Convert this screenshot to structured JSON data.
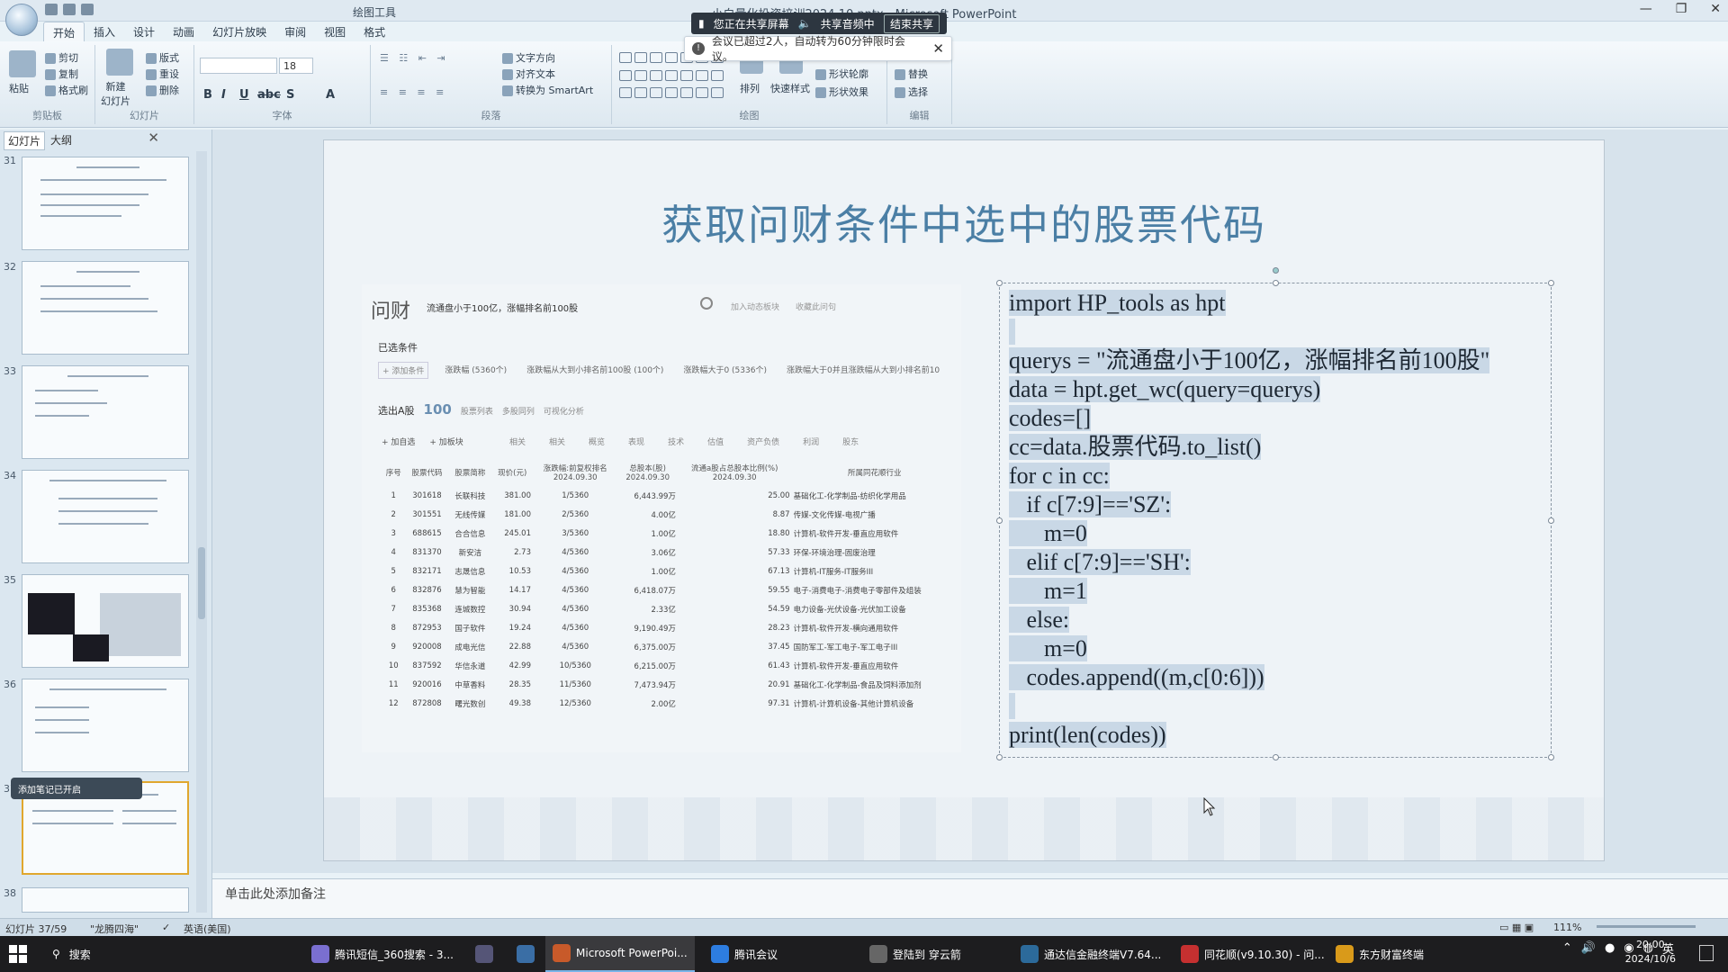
{
  "window": {
    "title": "小白量化投资培训2024.10.pptx - Microsoft PowerPoint",
    "context_tool": "绘图工具",
    "buttons": [
      "—",
      "❐",
      "✕"
    ]
  },
  "ribbon_tabs": [
    "开始",
    "插入",
    "设计",
    "动画",
    "幻灯片放映",
    "审阅",
    "视图",
    "格式"
  ],
  "ribbon": {
    "clipboard": {
      "paste": "粘贴",
      "cut": "剪切",
      "copy": "复制",
      "format_painter": "格式刷",
      "label": "剪贴板"
    },
    "slides": {
      "new_slide": "新建\n幻灯片",
      "layout": "版式",
      "reset": "重设",
      "delete": "删除",
      "label": "幻灯片"
    },
    "font": {
      "size": "18",
      "label": "字体"
    },
    "paragraph": {
      "text_direction": "文字方向",
      "align_text": "对齐文本",
      "smartart": "转换为 SmartArt",
      "label": "段落"
    },
    "drawing": {
      "arrange": "排列",
      "quick_styles": "快速样式",
      "shape_fill": "形状轮廓",
      "shape_effects": "形状效果",
      "label": "绘图"
    },
    "editing": {
      "replace": "替换",
      "select": "选择",
      "label": "编辑"
    }
  },
  "share_banner": {
    "text": "您正在共享屏幕",
    "audio": "共享音频中",
    "end": "结束共享"
  },
  "notice": {
    "text": "会议已超过2人，自动转为60分钟限时会议。",
    "close": "✕"
  },
  "panel": {
    "tabs": [
      "幻灯片",
      "大纲"
    ],
    "close": "✕",
    "slide_numbers": [
      "31",
      "32",
      "33",
      "34",
      "35",
      "36",
      "37",
      "38"
    ],
    "float_bar": "添加笔记已开启"
  },
  "slide": {
    "title": "获取问财条件中选中的股票代码",
    "wencai": {
      "logo": "问财",
      "query": "流通盘小于100亿，涨幅排名前100股",
      "links": [
        "加入动态板块",
        "收藏此问句"
      ],
      "selected_label": "已选条件",
      "chips": [
        "+ 添加条件",
        "涨跌幅 (5360个)",
        "涨跌幅从大到小排名前100股 (100个)",
        "涨跌幅大于0 (5336个)",
        "涨跌幅大于0并且涨跌幅从大到小排名前10"
      ],
      "count_label": "选出A股",
      "count": "100",
      "view_tabs": [
        "股票列表",
        "多股同列",
        "可视化分析"
      ],
      "tools": [
        "+ 加自选",
        "+ 加板块"
      ],
      "categories": [
        "相关",
        "相关",
        "概览",
        "表现",
        "技术",
        "估值",
        "资产负债",
        "利润",
        "股东"
      ],
      "columns": [
        "序号",
        "股票代码",
        "股票简称",
        "现价(元)",
        "涨跌幅:前复权排名\n2024.09.30",
        "总股本(股)\n2024.09.30",
        "流通a股占总股本比例(%)\n2024.09.30",
        "所属同花顺行业"
      ],
      "rows": [
        [
          "1",
          "301618",
          "长联科技",
          "381.00",
          "1/5360",
          "6,443.99万",
          "25.00",
          "基础化工-化学制品-纺织化学用品"
        ],
        [
          "2",
          "301551",
          "无线传媒",
          "181.00",
          "2/5360",
          "4.00亿",
          "8.87",
          "传媒-文化传媒-电视广播"
        ],
        [
          "3",
          "688615",
          "合合信息",
          "245.01",
          "3/5360",
          "1.00亿",
          "18.80",
          "计算机-软件开发-垂直应用软件"
        ],
        [
          "4",
          "831370",
          "新安洁",
          "2.73",
          "4/5360",
          "3.06亿",
          "57.33",
          "环保-环境治理-固废治理"
        ],
        [
          "5",
          "832171",
          "志晟信息",
          "10.53",
          "4/5360",
          "1.00亿",
          "67.13",
          "计算机-IT服务-IT服务III"
        ],
        [
          "6",
          "832876",
          "慧为智能",
          "14.17",
          "4/5360",
          "6,418.07万",
          "59.55",
          "电子-消费电子-消费电子零部件及组装"
        ],
        [
          "7",
          "835368",
          "连城数控",
          "30.94",
          "4/5360",
          "2.33亿",
          "54.59",
          "电力设备-光伏设备-光伏加工设备"
        ],
        [
          "8",
          "872953",
          "国子软件",
          "19.24",
          "4/5360",
          "9,190.49万",
          "28.23",
          "计算机-软件开发-横向通用软件"
        ],
        [
          "9",
          "920008",
          "成电光信",
          "22.88",
          "4/5360",
          "6,375.00万",
          "37.45",
          "国防军工-军工电子-军工电子III"
        ],
        [
          "10",
          "837592",
          "华信永道",
          "42.99",
          "10/5360",
          "6,215.00万",
          "61.43",
          "计算机-软件开发-垂直应用软件"
        ],
        [
          "11",
          "920016",
          "中草香料",
          "28.35",
          "11/5360",
          "7,473.94万",
          "20.91",
          "基础化工-化学制品-食品及饲料添加剂"
        ],
        [
          "12",
          "872808",
          "曙光数创",
          "49.38",
          "12/5360",
          "2.00亿",
          "97.31",
          "计算机-计算机设备-其他计算机设备"
        ]
      ]
    },
    "code_lines": [
      "import HP_tools as hpt",
      "",
      "querys = \"流通盘小于100亿，涨幅排名前100股\"",
      "data = hpt.get_wc(query=querys)",
      "codes=[]",
      "cc=data.股票代码.to_list()",
      "for c in cc:",
      "   if c[7:9]=='SZ':",
      "      m=0",
      "   elif c[7:9]=='SH':",
      "      m=1",
      "   else:",
      "      m=0",
      "   codes.append((m,c[0:6]))",
      "",
      "print(len(codes))"
    ]
  },
  "notes_placeholder": "单击此处添加备注",
  "status": {
    "slide_info": "幻灯片 37/59",
    "theme": "\"龙腾四海\"",
    "language": "英语(美国)",
    "zoom": "111%"
  },
  "taskbar": {
    "search": "搜索",
    "items": [
      "腾讯短信_360搜索 - 3...",
      "Microsoft PowerPoi...",
      "腾讯会议",
      "登陆到 穿云箭",
      "通达信金融终端V7.64...",
      "同花顺(v9.10.30) - 问...",
      "东方财富终端"
    ],
    "ime": "英",
    "time": "20:00",
    "date": "2024/10/6"
  }
}
